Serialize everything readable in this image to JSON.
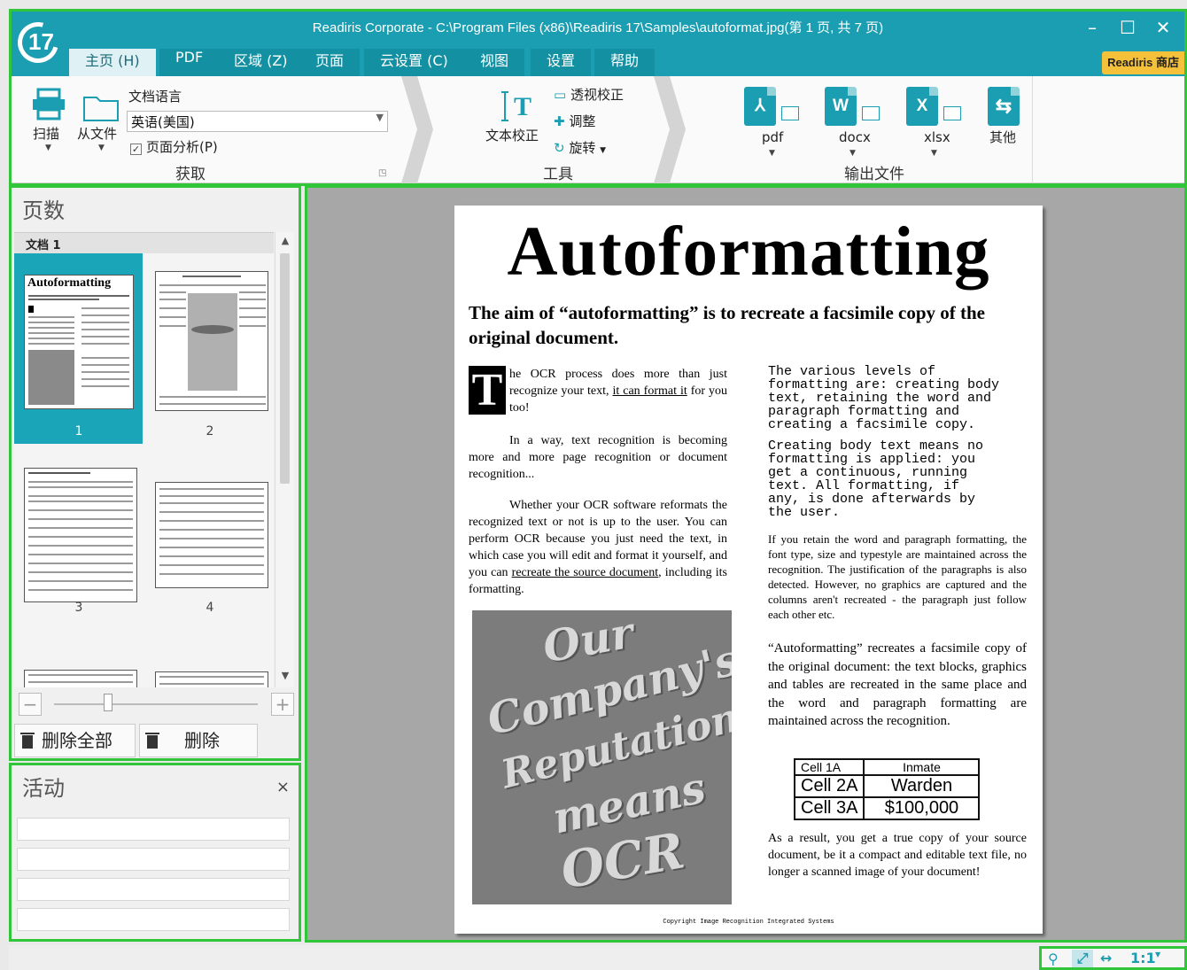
{
  "window": {
    "title": "Readiris Corporate - C:\\Program Files (x86)\\Readiris 17\\Samples\\autoformat.jpg(第 1 页, 共 7 页)",
    "logo": "17",
    "minimize_icon": "minimize-icon",
    "maximize_icon": "maximize-icon",
    "close_icon": "close-icon"
  },
  "tabs": [
    {
      "label": "主页 (H)",
      "active": true
    },
    {
      "label": "PDF"
    },
    {
      "label": "区域 (Z)"
    },
    {
      "label": "页面"
    },
    {
      "label": "云设置 (C)"
    },
    {
      "label": "视图"
    },
    {
      "label": "设置"
    },
    {
      "label": "帮助"
    }
  ],
  "store_button": "Readiris 商店",
  "ribbon": {
    "acquire": {
      "scan": "扫描",
      "from_file": "从文件",
      "doc_language_label": "文档语言",
      "doc_language_value": "英语(美国)",
      "page_analysis": "页面分析(P)",
      "page_analysis_checked": true,
      "group_label": "获取"
    },
    "tools": {
      "text_correction": "文本校正",
      "perspective": "透视校正",
      "adjust": "调整",
      "rotate": "旋转",
      "group_label": "工具"
    },
    "output": {
      "pdf": "pdf",
      "docx": "docx",
      "xlsx": "xlsx",
      "other": "其他",
      "group_label": "输出文件"
    },
    "colors": {
      "pdf": "#1a9fc0",
      "docx": "#1a9fc0",
      "xlsx": "#1a9fc0",
      "other": "#1a9fc0"
    }
  },
  "pages_panel": {
    "title": "页数",
    "doc_label": "文档 1",
    "page_numbers": [
      "1",
      "2",
      "3",
      "4"
    ],
    "thumb1_title": "Autoformatting",
    "delete_all": "删除全部",
    "delete": "删除"
  },
  "activity_panel": {
    "title": "活动",
    "close": "×"
  },
  "document": {
    "title": "Autoformatting",
    "subtitle": "The aim of “autoformatting” is to recreate a facsimile copy of the original document.",
    "dropcap": "T",
    "left_p1_a": "he OCR process does more than just recognize your text, ",
    "left_p1_link": "it can format it",
    "left_p1_b": " for you too!",
    "left_p2": "In a way, text recognition is becoming more and more page recognition or document recognition...",
    "left_p3_a": "Whether your OCR software reformats the recognized text or not is up to the user. You can perform OCR because you just need the text, in which case you will edit and format it yourself, and you can ",
    "left_p3_link": "recreate the source document",
    "left_p3_b": ", including its formatting.",
    "image_text": [
      "Our",
      "Company's",
      "Reputation",
      "means",
      "OCR"
    ],
    "right_mono1": "The various levels of\nformatting are: creating body\ntext, retaining the word and\nparagraph formatting and\ncreating a facsimile copy.",
    "right_mono2": "Creating body text means no\nformatting is applied: you\nget a continuous, running\ntext. All formatting, if\nany, is done afterwards by\nthe user.",
    "right_p1": "If you retain the word and paragraph formatting, the font type, size and typestyle are maintained across the recognition. The justification of the paragraphs is also detected. However, no graphics are captured and the columns aren't recreated - the paragraph just follow each other etc.",
    "right_p2": "“Autoformatting” recreates a facsimile copy of the original document: the text blocks, graphics and tables are recreated in the same place and the word and paragraph formatting are maintained across the recognition.",
    "table": [
      [
        "Cell 1A",
        "Inmate"
      ],
      [
        "Cell 2A",
        "Warden"
      ],
      [
        "Cell 3A",
        "$100,000"
      ]
    ],
    "right_p3": "As a result, you get a true copy of your source document, be it a compact and editable text file, no longer a scanned image of your document!",
    "footer": "Copyright Image Recognition Integrated Systems"
  },
  "statusbar": {
    "zoom_label": "1:1",
    "search_icon": "search-icon",
    "fit_page_icon": "fit-page-icon",
    "fit_width_icon": "fit-width-icon"
  }
}
